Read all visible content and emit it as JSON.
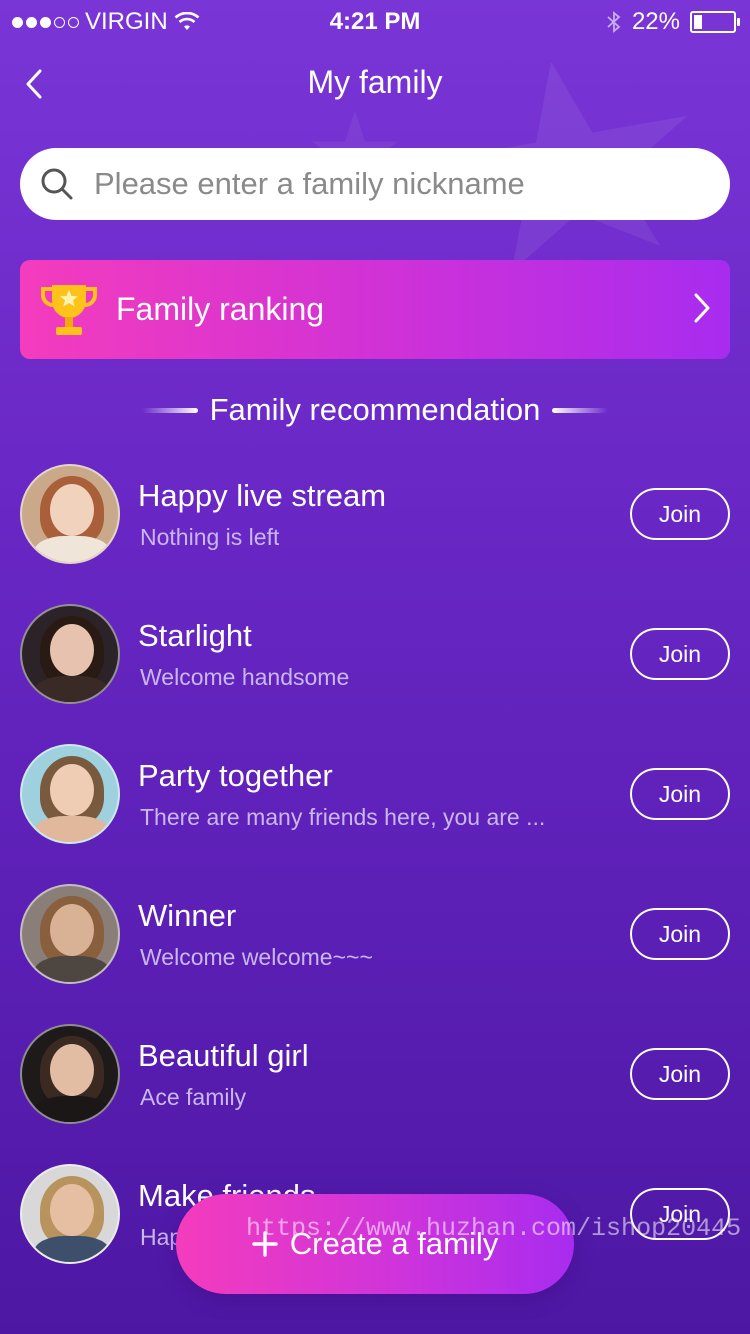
{
  "status_bar": {
    "carrier": "VIRGIN",
    "time": "4:21 PM",
    "battery": "22%",
    "battery_level": 0.22
  },
  "nav": {
    "title": "My family"
  },
  "search": {
    "placeholder": "Please enter a family nickname"
  },
  "ranking": {
    "label": "Family ranking"
  },
  "section": {
    "heading": "Family recommendation"
  },
  "families": [
    {
      "name": "Happy live stream",
      "subtitle": "Nothing is left",
      "action": "Join"
    },
    {
      "name": "Starlight",
      "subtitle": "Welcome handsome",
      "action": "Join"
    },
    {
      "name": "Party together",
      "subtitle": "There are many friends here, you are ...",
      "action": "Join"
    },
    {
      "name": "Winner",
      "subtitle": "Welcome welcome~~~",
      "action": "Join"
    },
    {
      "name": "Beautiful girl",
      "subtitle": "Ace family",
      "action": "Join"
    },
    {
      "name": "Make friends",
      "subtitle": "Happy",
      "action": "Join"
    }
  ],
  "create_button": {
    "label": "Create a family",
    "icon": "plus-icon"
  },
  "watermark": "https://www.huzhan.com/ishop20445",
  "colors": {
    "accent_pink": "#f43cbd",
    "accent_purple": "#a82cef",
    "background": "#6a28c6"
  }
}
